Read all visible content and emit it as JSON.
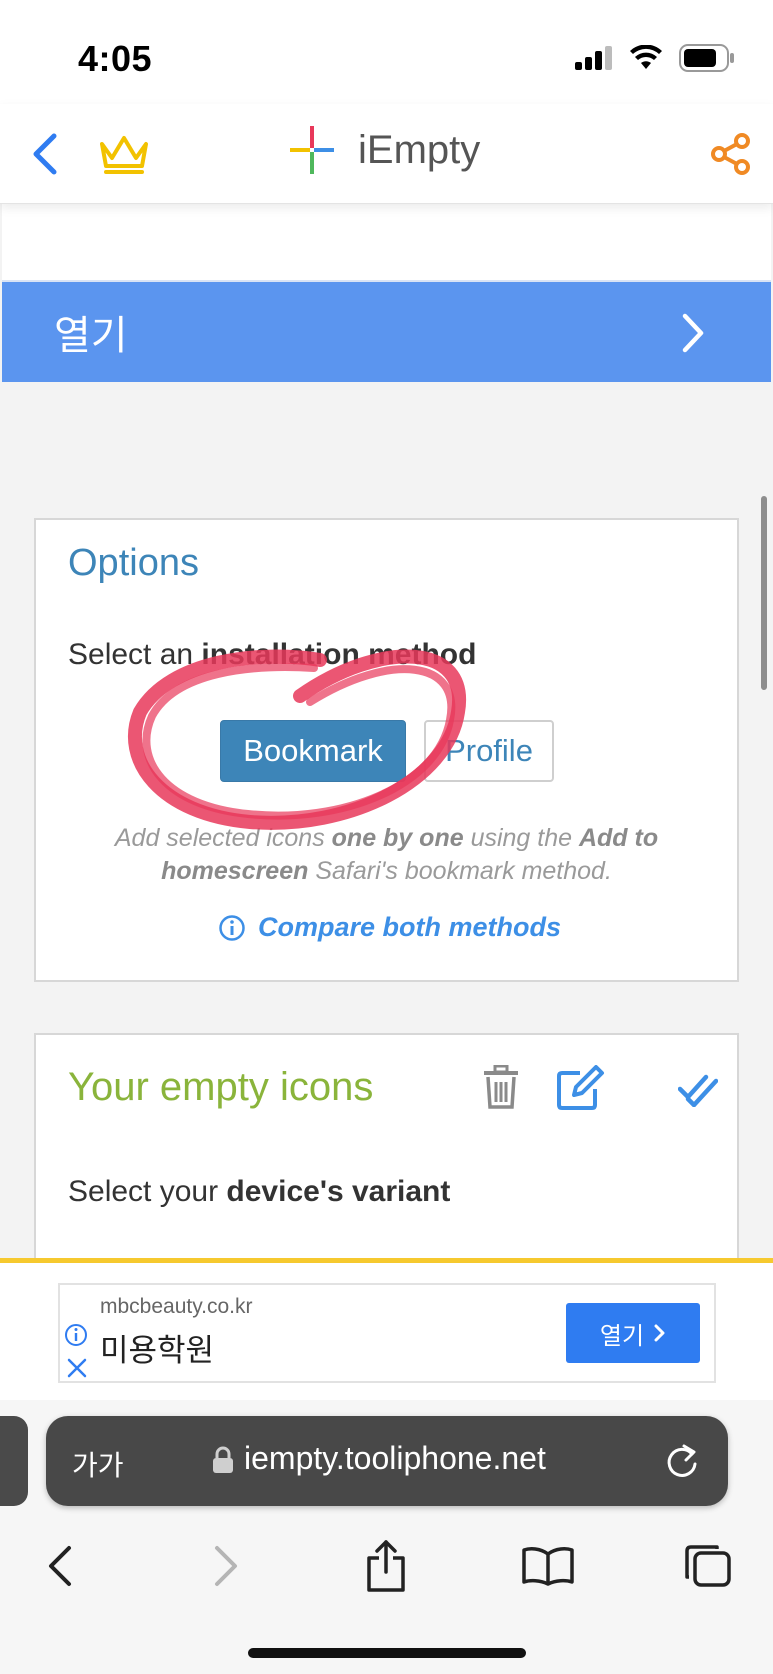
{
  "status_bar": {
    "time": "4:05"
  },
  "header": {
    "app_name": "iEmpty"
  },
  "open_banner": {
    "label": "열기"
  },
  "options": {
    "title": "Options",
    "select_prefix": "Select an ",
    "select_bold": "installation method",
    "methods": [
      "Bookmark",
      "Profile"
    ],
    "selected_method": "Bookmark",
    "description": {
      "part1": "Add selected icons ",
      "bold1": "one by one",
      "part2": " using the ",
      "bold2": "Add to homescreen",
      "part3": " Safari's bookmark method."
    },
    "compare_link": "Compare both methods"
  },
  "icons_section": {
    "title": "Your empty icons",
    "variant_prefix": "Select your ",
    "variant_bold": "device's variant"
  },
  "ad": {
    "domain": "mbcbeauty.co.kr",
    "name": "미용학원",
    "button": "열기"
  },
  "safari": {
    "text_size_label": "가가",
    "url": "iempty.tooliphone.net"
  },
  "colors": {
    "banner": "#5b95ef",
    "primary_button": "#3d85b8",
    "icons_title": "#8ab43b",
    "link": "#3d8fe6",
    "annotation": "#e8385a",
    "ad_button": "#2f7cf1"
  }
}
